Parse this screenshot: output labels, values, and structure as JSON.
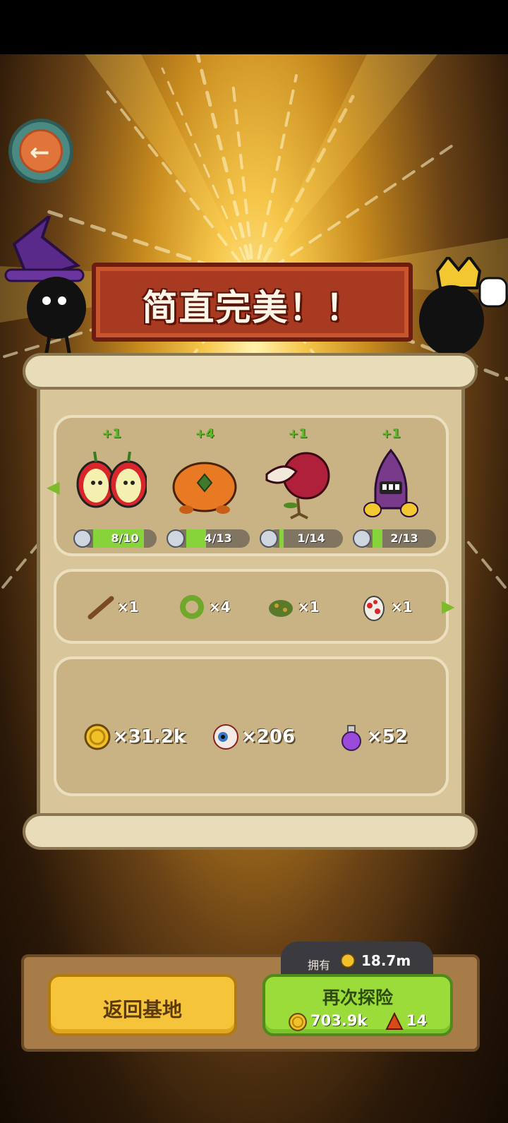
{
  "banner": {
    "title": "简直完美！！"
  },
  "monsters": [
    {
      "plus": "+1",
      "progress_text": "8/10",
      "progress": 0.8,
      "icon": "apple-halves-monster-icon"
    },
    {
      "plus": "+4",
      "progress_text": "4/13",
      "progress": 0.31,
      "icon": "orange-blob-monster-icon"
    },
    {
      "plus": "+1",
      "progress_text": "1/14",
      "progress": 0.07,
      "icon": "flytrap-plant-monster-icon"
    },
    {
      "plus": "+1",
      "progress_text": "2/13",
      "progress": 0.15,
      "icon": "robot-monster-icon"
    }
  ],
  "items": [
    {
      "icon": "stick-icon",
      "count": "×1"
    },
    {
      "icon": "green-wreath-icon",
      "count": "×4"
    },
    {
      "icon": "herb-bundle-icon",
      "count": "×1"
    },
    {
      "icon": "spotted-egg-icon",
      "count": "×1"
    }
  ],
  "resources": [
    {
      "icon": "gold-coin-icon",
      "count": "×31.2k"
    },
    {
      "icon": "eyeball-icon",
      "count": "×206"
    },
    {
      "icon": "potion-icon",
      "count": "×52"
    }
  ],
  "footer": {
    "return_label": "返回基地",
    "own_label": "拥有",
    "own_value": "18.7m",
    "again_label": "再次探险",
    "again_cost": "703.9k",
    "again_ticket": "14"
  },
  "colors": {
    "accent_green": "#9bdc3a",
    "accent_yellow": "#f5c43b",
    "banner_red": "#a83a22"
  }
}
